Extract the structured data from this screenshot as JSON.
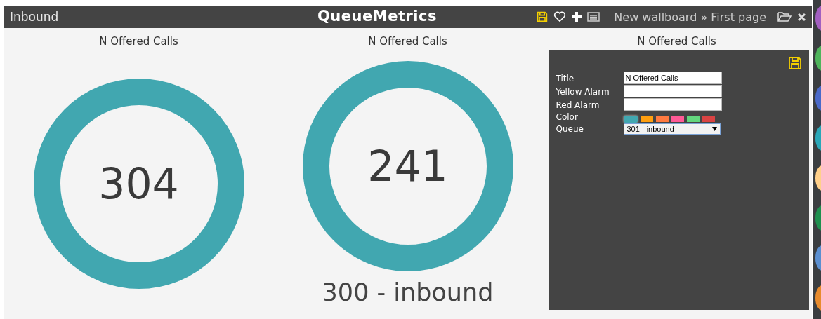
{
  "top_bar": {
    "title": "Inbound",
    "brand": "QueueMetrics",
    "breadcrumb": "New wallboard » First page"
  },
  "widgets": [
    {
      "kind": "donut",
      "title": "N Offered Calls",
      "value": "304"
    },
    {
      "kind": "donut",
      "title": "N Offered Calls",
      "value": "241",
      "queue": "300 - inbound"
    },
    {
      "kind": "editor",
      "title": "N Offered Calls",
      "fields": [
        {
          "label": "Title",
          "value": "N Offered Calls"
        },
        {
          "label": "Yellow Alarm"
        },
        {
          "label": "Red Alarm"
        }
      ],
      "color_label": "Color",
      "colors": [
        {
          "color": "#41a7b0",
          "selected": true
        },
        {
          "color": "#ff9f0f",
          "selected": false
        },
        {
          "color": "#ff7a40",
          "selected": false
        },
        {
          "color": "#ff5a96",
          "selected": false
        },
        {
          "color": "#63d67d",
          "selected": false
        },
        {
          "color": "#d94343",
          "selected": false
        }
      ],
      "queue_label": "Queue",
      "queue_value": "301 - inbound"
    }
  ]
}
